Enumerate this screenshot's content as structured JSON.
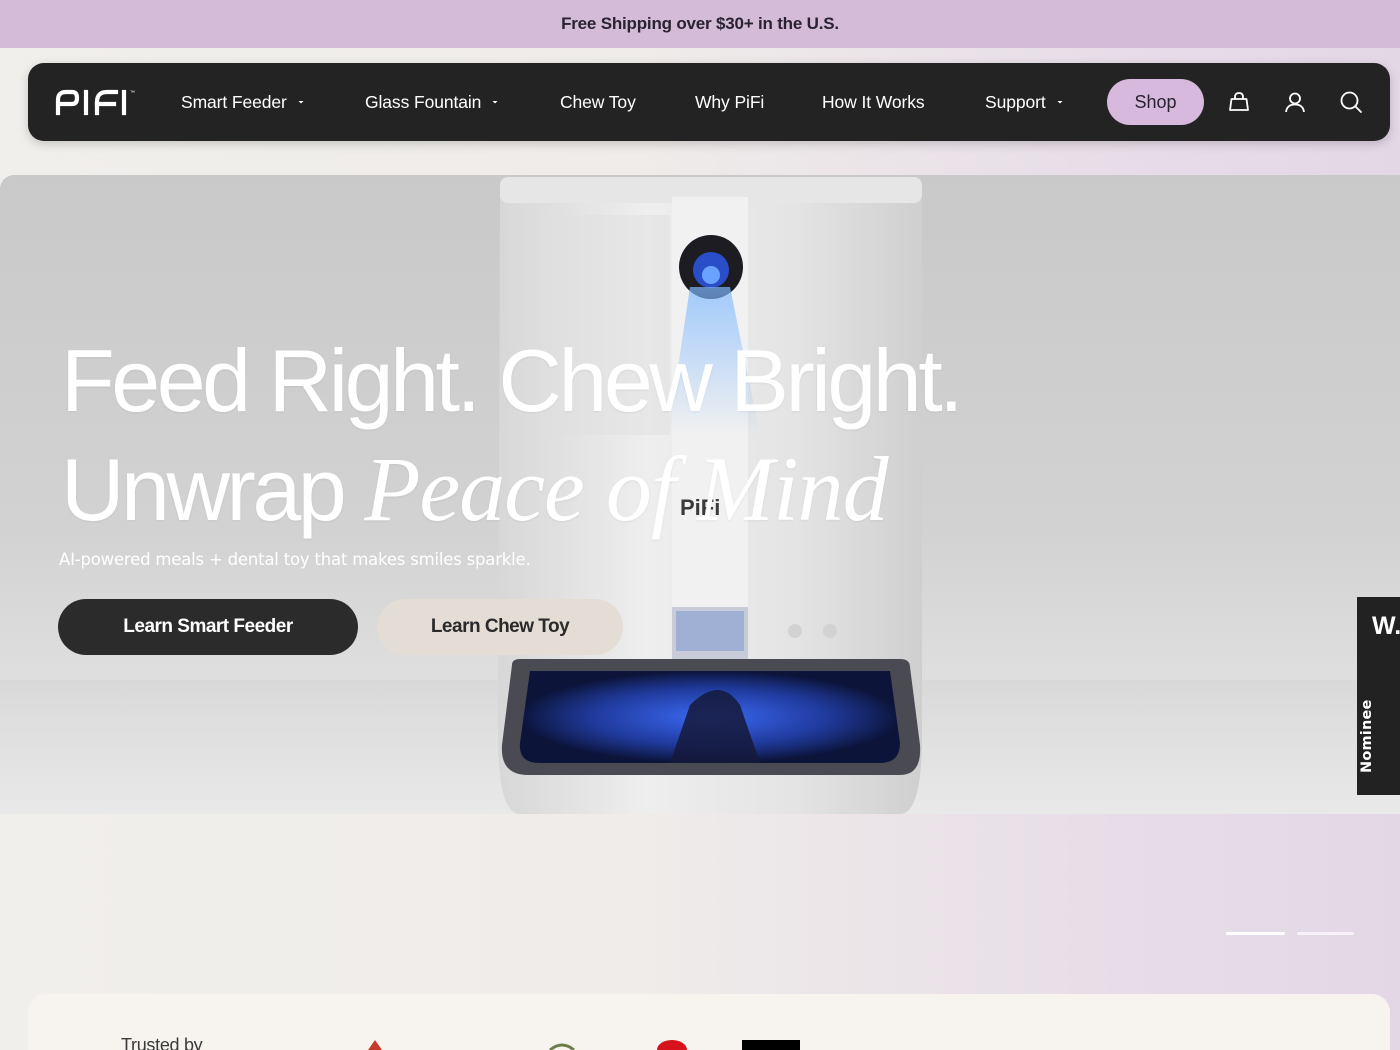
{
  "announcement": {
    "text": "Free Shipping over $30+ in the U.S."
  },
  "nav": {
    "logo_text": "PIFI",
    "items": [
      {
        "label": "Smart Feeder",
        "has_dropdown": true
      },
      {
        "label": "Glass Fountain",
        "has_dropdown": true
      },
      {
        "label": "Chew Toy",
        "has_dropdown": false
      },
      {
        "label": "Why PiFi",
        "has_dropdown": false
      },
      {
        "label": "How It Works",
        "has_dropdown": false
      },
      {
        "label": "Support",
        "has_dropdown": true
      }
    ],
    "shop_label": "Shop",
    "icons": [
      "bag-icon",
      "user-icon",
      "search-icon"
    ],
    "shop_color": "#d6b9dc"
  },
  "hero": {
    "title_line1": "Feed Right. Chew Bright.",
    "title_line2_plain": "Unwrap",
    "title_line2_italic": "Peace of Mind",
    "subtitle": "AI-powered meals + dental toy that makes smiles sparkle.",
    "primary_button": "Learn Smart Feeder",
    "secondary_button": "Learn Chew Toy",
    "device_brand": "PiFi"
  },
  "side_badge": {
    "letter": "W.",
    "label": "Nominee"
  },
  "carousel": {
    "slides": 2,
    "active_slide": 1
  },
  "trusted": {
    "label": "Trusted by"
  },
  "colors": {
    "announce_bg": "#d4bcd9",
    "nav_bg": "#232323",
    "accent": "#d6b9dc",
    "button_dark": "#2b2b2b",
    "button_light": "#e3ddd6"
  }
}
